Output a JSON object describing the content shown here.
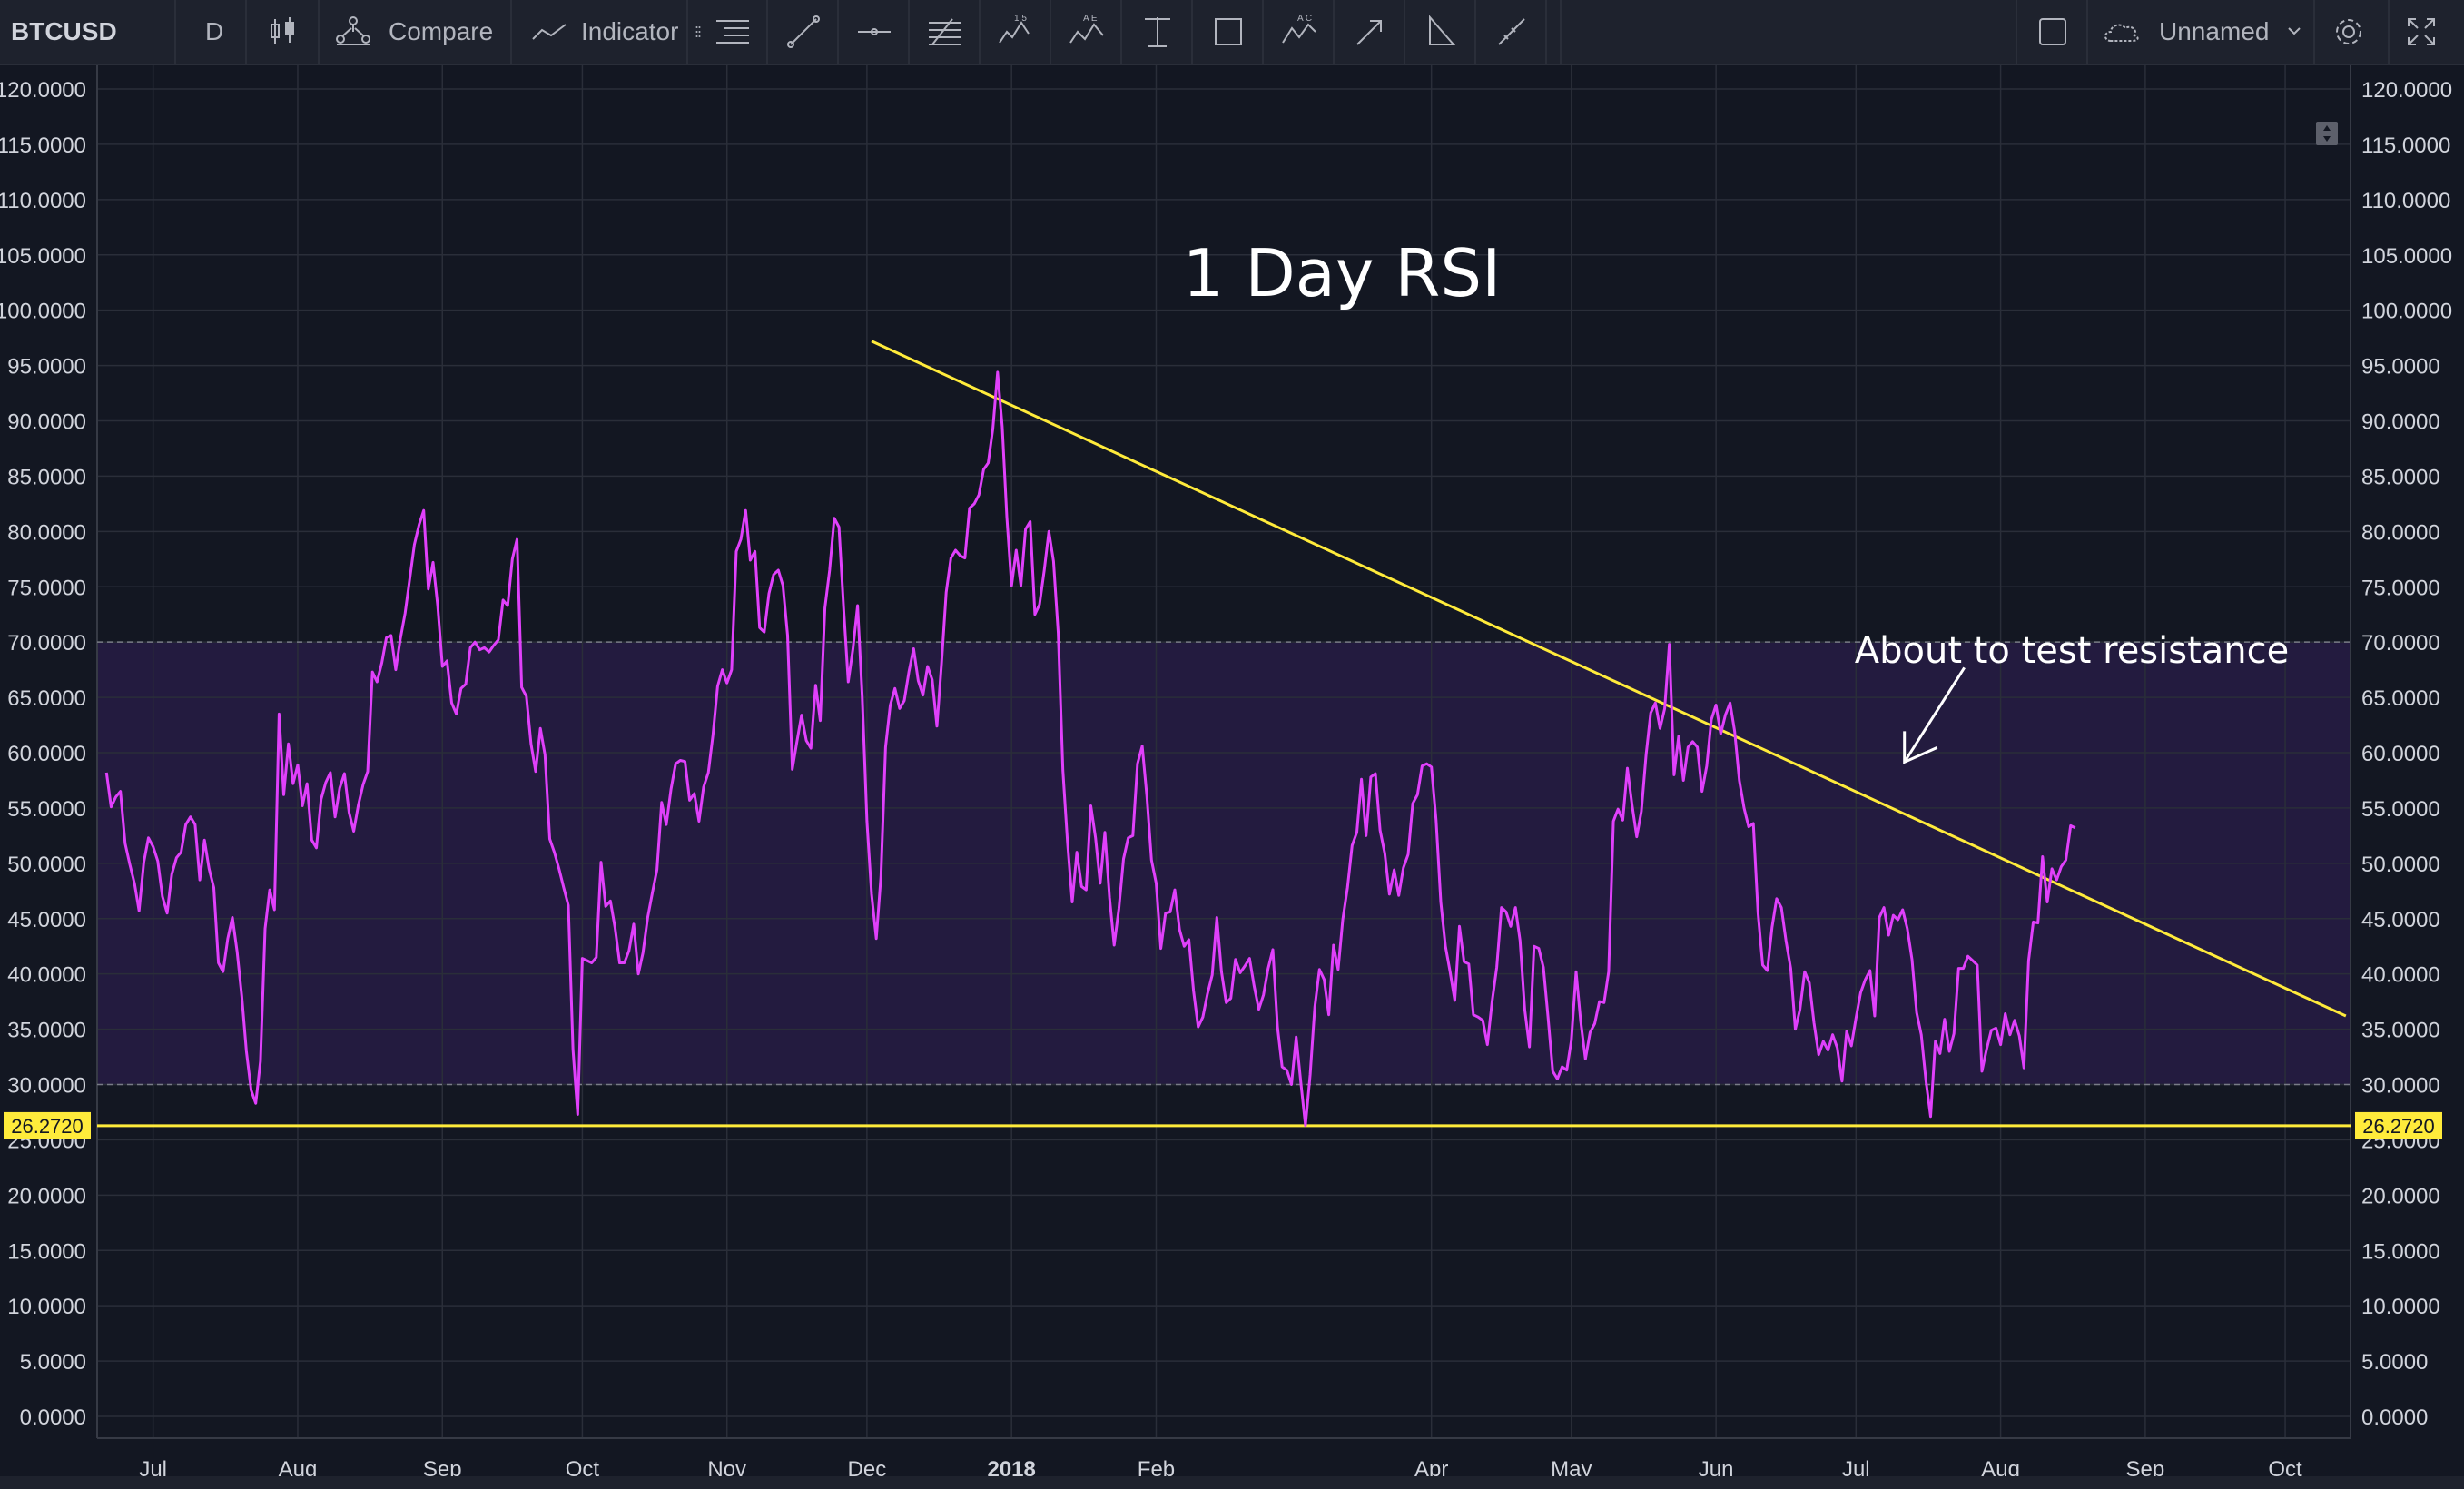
{
  "toolbar": {
    "symbol": "BTCUSD",
    "interval": "D",
    "compare_label": "Compare",
    "indicator_label": "Indicator",
    "layout_name": "Unnamed"
  },
  "drawing_tools": [
    {
      "icon": "drag-handle-icon"
    },
    {
      "icon": "horizontal-lines-icon"
    },
    {
      "icon": "trend-line-icon"
    },
    {
      "icon": "horizontal-ray-icon"
    },
    {
      "icon": "fib-retracement-icon"
    },
    {
      "icon": "elliott-wave-icon"
    },
    {
      "icon": "xabcd-pattern-icon"
    },
    {
      "icon": "text-cursor-icon"
    },
    {
      "icon": "rectangle-icon"
    },
    {
      "icon": "abcd-pattern-icon"
    },
    {
      "icon": "arrow-icon"
    },
    {
      "icon": "angle-icon"
    },
    {
      "icon": "measure-icon"
    }
  ],
  "colors": {
    "background": "#131722",
    "rsi_line": "#e040fb",
    "band_fill": "#2a1e4a",
    "trend_line": "#ffeb3b",
    "grid": "#2a2e39",
    "level_label_bg": "#ffeb3b"
  },
  "chart_data": {
    "type": "line",
    "title": "1 Day RSI",
    "annotation": "About to test resistance",
    "y_ticks": [
      "0.0000",
      "5.0000",
      "10.0000",
      "15.0000",
      "20.0000",
      "25.0000",
      "30.0000",
      "35.0000",
      "40.0000",
      "45.0000",
      "50.0000",
      "55.0000",
      "60.0000",
      "65.0000",
      "70.0000",
      "75.0000",
      "80.0000",
      "85.0000",
      "90.0000",
      "95.0000",
      "100.0000",
      "105.0000",
      "110.0000",
      "115.0000",
      "120.0000"
    ],
    "ylim": [
      0,
      120
    ],
    "x_ticks": [
      {
        "label": "Jul",
        "day": 10
      },
      {
        "label": "Aug",
        "day": 41
      },
      {
        "label": "Sep",
        "day": 72
      },
      {
        "label": "Oct",
        "day": 102
      },
      {
        "label": "Nov",
        "day": 133
      },
      {
        "label": "Dec",
        "day": 163
      },
      {
        "label": "2018",
        "day": 194,
        "bold": true
      },
      {
        "label": "Feb",
        "day": 225
      },
      {
        "label": "Apr",
        "day": 284
      },
      {
        "label": "May",
        "day": 314
      },
      {
        "label": "Jun",
        "day": 345
      },
      {
        "label": "Jul",
        "day": 375
      },
      {
        "label": "Aug",
        "day": 406
      },
      {
        "label": "Sep",
        "day": 437
      },
      {
        "label": "Oct",
        "day": 467
      }
    ],
    "xlim": [
      -2,
      481
    ],
    "overbought": 70,
    "oversold": 30,
    "support_level": 26.272,
    "support_label": "26.2720",
    "resistance_line": {
      "start": [
        164,
        97.2
      ],
      "end": [
        480,
        36.2
      ]
    },
    "annotation_target": [
      385,
      58
    ],
    "series": [
      {
        "values": [
          58.2,
          55.1,
          56.0,
          56.5,
          51.8,
          49.9,
          48.2,
          45.7,
          50.1,
          52.3,
          51.5,
          50.2,
          47.0,
          45.5,
          49.0,
          50.5,
          51.0,
          53.5,
          54.2,
          53.5,
          48.5,
          52.1,
          49.5,
          47.8,
          41.0,
          40.2,
          43.2,
          45.1,
          42.0,
          38.0,
          33.0,
          29.5,
          28.3,
          32.1,
          44.1,
          47.6,
          45.8,
          63.5,
          56.2,
          60.8,
          57.2,
          58.9,
          55.2,
          57.2,
          52.1,
          51.4,
          55.8,
          57.3,
          58.2,
          54.2,
          56.8,
          58.1,
          54.6,
          52.9,
          55.3,
          57.1,
          58.3,
          67.3,
          66.4,
          68.1,
          70.4,
          70.6,
          67.5,
          70.3,
          72.6,
          75.7,
          78.8,
          80.6,
          81.9,
          74.8,
          77.2,
          73.3,
          67.8,
          68.3,
          64.5,
          63.5,
          65.8,
          66.2,
          69.5,
          70.0,
          69.3,
          69.5,
          69.1,
          69.7,
          70.2,
          73.8,
          73.3,
          77.5,
          79.3,
          65.9,
          65.1,
          60.8,
          58.3,
          62.2,
          59.8,
          52.2,
          51.0,
          49.5,
          47.8,
          46.2,
          33.2,
          27.3,
          41.4,
          41.2,
          41.0,
          41.5,
          50.1,
          46.1,
          46.6,
          44.2,
          41.0,
          41.0,
          42.1,
          44.5,
          40.0,
          41.9,
          45.1,
          47.3,
          49.4,
          55.5,
          53.5,
          56.7,
          59.0,
          59.3,
          59.2,
          55.7,
          56.3,
          53.8,
          56.9,
          58.2,
          61.6,
          66.0,
          67.5,
          66.3,
          67.5,
          78.2,
          79.3,
          81.9,
          77.4,
          78.2,
          71.3,
          70.9,
          74.4,
          76.1,
          76.5,
          75.1,
          70.6,
          58.5,
          61.0,
          63.4,
          61.1,
          60.4,
          66.1,
          62.9,
          73.1,
          76.5,
          81.2,
          80.4,
          73.1,
          66.4,
          69.4,
          73.3,
          65.1,
          53.8,
          47.2,
          43.2,
          48.8,
          60.5,
          64.3,
          65.8,
          64.0,
          64.7,
          67.3,
          69.4,
          66.5,
          65.2,
          67.8,
          66.6,
          62.4,
          68.1,
          74.5,
          77.6,
          78.3,
          77.8,
          77.6,
          82.1,
          82.5,
          83.3,
          85.6,
          86.2,
          89.3,
          94.4,
          89.5,
          81.3,
          75.1,
          78.3,
          75.1,
          80.2,
          80.9,
          72.5,
          73.4,
          76.5,
          80.0,
          77.3,
          70.8,
          58.4,
          51.8,
          46.5,
          51.0,
          47.9,
          47.6,
          55.2,
          52.3,
          48.2,
          52.8,
          46.9,
          42.6,
          45.9,
          50.4,
          52.3,
          52.5,
          59.0,
          60.6,
          56.1,
          50.3,
          48.2,
          42.3,
          45.5,
          45.6,
          47.6,
          44.0,
          42.5,
          43.1,
          38.5,
          35.2,
          36.1,
          38.2,
          39.9,
          45.1,
          40.2,
          37.4,
          37.8,
          41.3,
          40.1,
          40.7,
          41.4,
          38.9,
          36.8,
          38.1,
          40.5,
          42.2,
          35.2,
          31.6,
          31.3,
          30.0,
          34.3,
          30.2,
          26.3,
          30.9,
          37.0,
          40.4,
          39.5,
          36.3,
          42.6,
          40.4,
          44.9,
          47.8,
          51.6,
          52.8,
          57.6,
          52.5,
          57.8,
          58.1,
          53.0,
          50.9,
          47.2,
          49.4,
          47.1,
          49.6,
          50.8,
          55.4,
          56.2,
          58.8,
          59.0,
          58.7,
          53.9,
          46.5,
          42.5,
          40.2,
          37.6,
          44.3,
          41.1,
          40.9,
          36.3,
          36.1,
          35.8,
          33.6,
          37.5,
          40.6,
          46.0,
          45.6,
          44.3,
          46.0,
          43.0,
          36.8,
          33.4,
          42.5,
          42.3,
          40.6,
          36.1,
          31.2,
          30.5,
          31.6,
          31.3,
          34.0,
          40.2,
          35.7,
          32.3,
          34.7,
          35.5,
          37.5,
          37.4,
          40.2,
          53.8,
          54.9,
          53.9,
          58.6,
          55.3,
          52.4,
          54.7,
          59.8,
          63.6,
          64.5,
          62.2,
          64.0,
          69.8,
          58.0,
          61.5,
          57.5,
          60.5,
          61.0,
          60.5,
          56.5,
          58.8,
          63.0,
          64.3,
          61.7,
          63.4,
          64.5,
          61.9,
          57.5,
          55.0,
          53.3,
          53.6,
          45.5,
          40.8,
          40.3,
          44.2,
          46.8,
          46.0,
          43.0,
          40.5,
          35.0,
          36.8,
          40.2,
          39.2,
          35.6,
          32.7,
          33.9,
          33.1,
          34.5,
          33.3,
          30.3,
          34.8,
          33.5,
          36.0,
          38.3,
          39.5,
          40.3,
          36.2,
          45.1,
          46.0,
          43.5,
          45.3,
          44.9,
          45.8,
          44.1,
          41.3,
          36.5,
          34.5,
          30.3,
          27.1,
          33.9,
          32.8,
          35.9,
          33.0,
          34.6,
          40.5,
          40.5,
          41.6,
          41.2,
          40.8,
          31.2,
          33.2,
          34.9,
          35.1,
          33.6,
          36.4,
          34.5,
          35.8,
          34.4,
          31.5,
          41.2,
          44.7,
          44.6,
          50.6,
          46.5,
          49.5,
          48.5,
          49.7,
          50.3,
          53.4,
          53.2
        ]
      }
    ]
  }
}
